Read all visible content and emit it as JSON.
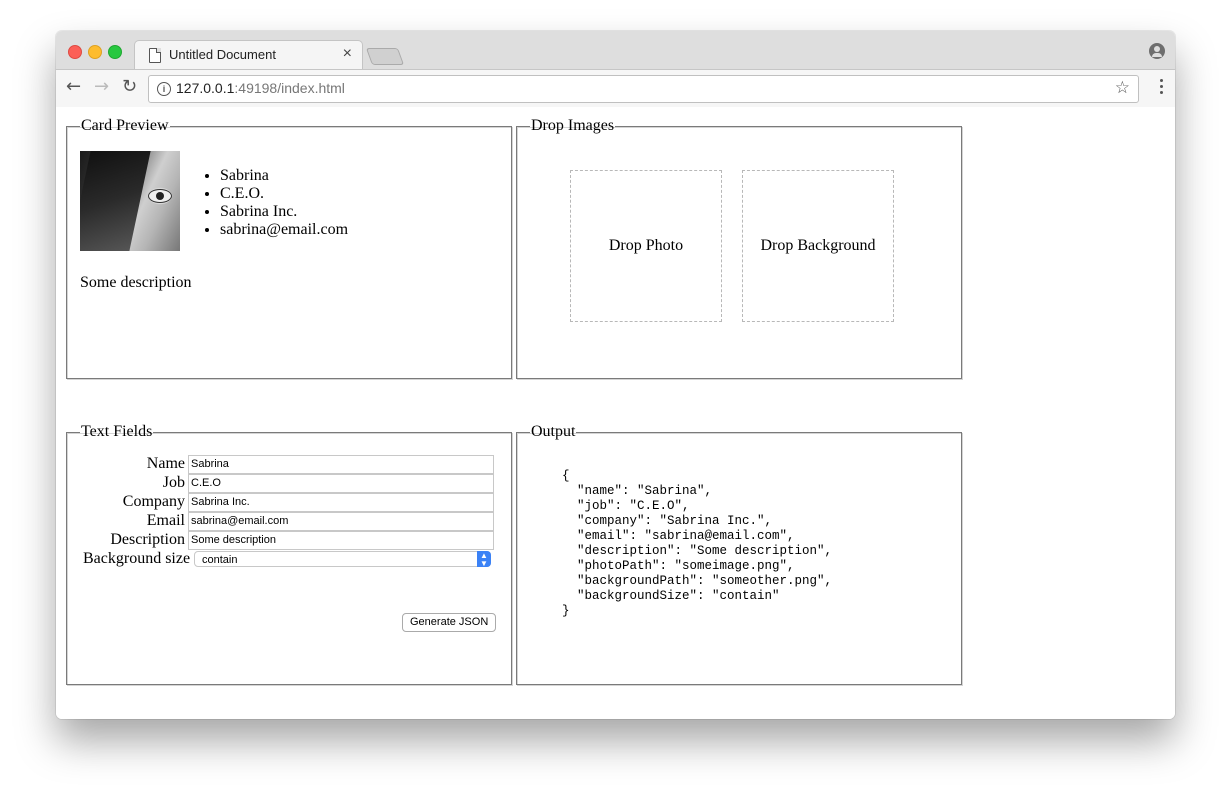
{
  "browser": {
    "tab_title": "Untitled Document",
    "tab_close": "×",
    "url_host": "127.0.0.1",
    "url_rest": ":49198/index.html",
    "back": "←",
    "forward": "→",
    "reload": "↻",
    "star": "☆"
  },
  "card_preview": {
    "legend": "Card Preview",
    "items": [
      "Sabrina",
      "C.E.O.",
      "Sabrina Inc.",
      "sabrina@email.com"
    ],
    "description": "Some description"
  },
  "drop_images": {
    "legend": "Drop Images",
    "photo_label": "Drop Photo",
    "background_label": "Drop Background"
  },
  "text_fields": {
    "legend": "Text Fields",
    "fields": [
      {
        "label": "Name",
        "value": "Sabrina"
      },
      {
        "label": "Job",
        "value": "C.E.O"
      },
      {
        "label": "Company",
        "value": "Sabrina Inc."
      },
      {
        "label": "Email",
        "value": "sabrina@email.com"
      },
      {
        "label": "Description",
        "value": "Some description"
      }
    ],
    "background_size_label": "Background size",
    "background_size_value": "contain",
    "generate_button": "Generate JSON"
  },
  "output": {
    "legend": "Output",
    "json_text": "{\n  \"name\": \"Sabrina\",\n  \"job\": \"C.E.O\",\n  \"company\": \"Sabrina Inc.\",\n  \"email\": \"sabrina@email.com\",\n  \"description\": \"Some description\",\n  \"photoPath\": \"someimage.png\",\n  \"backgroundPath\": \"someother.png\",\n  \"backgroundSize\": \"contain\"\n}"
  }
}
